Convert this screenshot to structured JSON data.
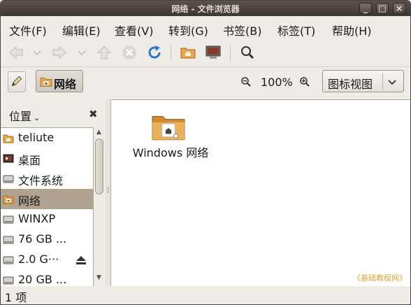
{
  "window": {
    "title": "网络 - 文件浏览器",
    "controls": {
      "minimize": "_",
      "maximize": "□",
      "close": "×"
    }
  },
  "menu": {
    "items": [
      "文件(F)",
      "编辑(E)",
      "查看(V)",
      "转到(G)",
      "书签(B)",
      "标签(T)",
      "帮助(H)"
    ]
  },
  "toolbar": {
    "icons": [
      "back-icon",
      "chevron-down-icon",
      "forward-icon",
      "chevron-down-icon",
      "up-icon",
      "stop-icon",
      "reload-icon",
      "home-folder-icon",
      "computer-icon",
      "search-icon"
    ]
  },
  "location": {
    "crumb": "网络",
    "zoom": "100%",
    "view_mode": "图标视图"
  },
  "sidebar": {
    "title": "位置",
    "close": "✖",
    "items": [
      {
        "label": "teliute",
        "icon": "home-folder-icon"
      },
      {
        "label": "桌面",
        "icon": "desktop-icon"
      },
      {
        "label": "文件系统",
        "icon": "drive-icon"
      },
      {
        "label": "网络",
        "icon": "network-folder-icon",
        "selected": true
      },
      {
        "label": "WINXP",
        "icon": "drive-icon"
      },
      {
        "label": "76 GB ...",
        "icon": "drive-icon"
      },
      {
        "label": "2.0 G···",
        "icon": "drive-icon",
        "eject": true
      },
      {
        "label": "20 GB ...",
        "icon": "drive-icon"
      }
    ]
  },
  "main": {
    "items": [
      {
        "label": "Windows 网络",
        "icon": "network-folder-icon"
      }
    ],
    "watermark": "《基础教程网》"
  },
  "status": {
    "text": "1 项"
  },
  "colors": {
    "titlebar": "#3c3730",
    "selection": "#b0a392",
    "folder": "#e8a84a",
    "watermark": "#d9a640"
  }
}
